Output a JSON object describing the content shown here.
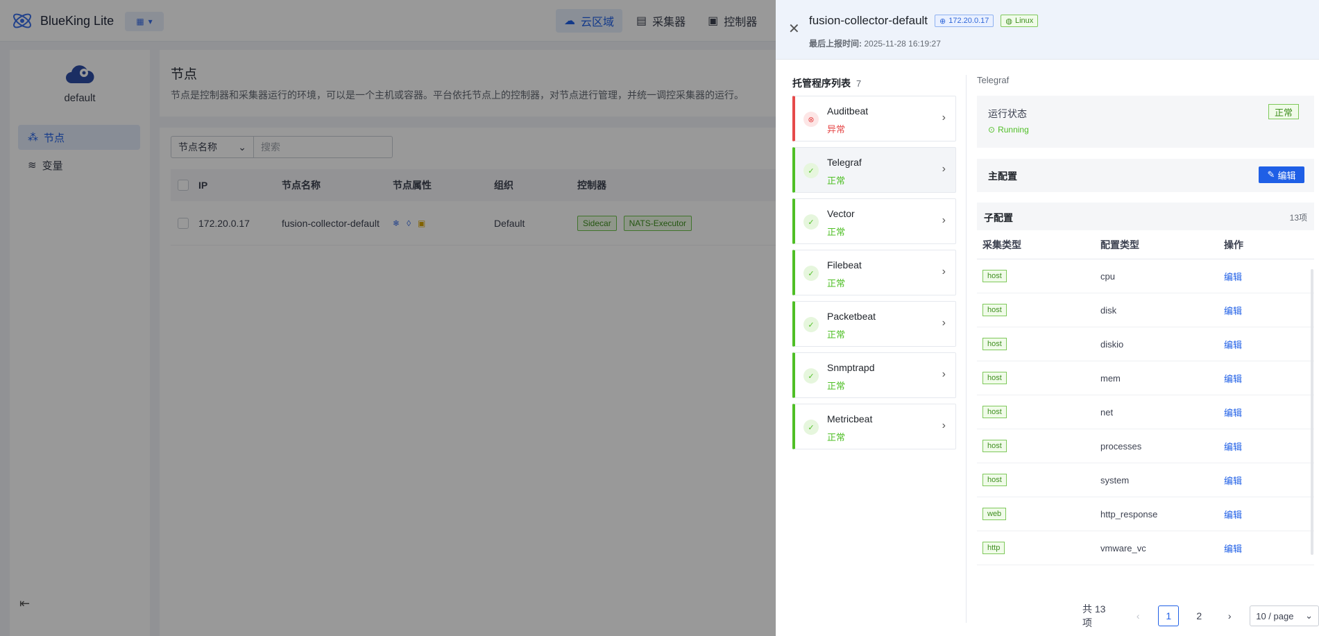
{
  "app": {
    "title": "BlueKing Lite"
  },
  "topnav": [
    {
      "label": "云区域",
      "icon": "cloud-icon",
      "active": true
    },
    {
      "label": "采集器",
      "icon": "collector-icon"
    },
    {
      "label": "控制器",
      "icon": "controller-icon"
    }
  ],
  "sidebar": {
    "cloud_name": "default",
    "items": [
      {
        "label": "节点",
        "active": true
      },
      {
        "label": "变量"
      }
    ]
  },
  "content": {
    "title": "节点",
    "description": "节点是控制器和采集器运行的环境，可以是一个主机或容器。平台依托节点上的控制器，对节点进行管理，并统一调控采集器的运行。",
    "filter": {
      "select": "节点名称",
      "placeholder": "搜索"
    },
    "table": {
      "headers": [
        "IP",
        "节点名称",
        "节点属性",
        "组织",
        "控制器"
      ],
      "rows": [
        {
          "ip": "172.20.0.17",
          "name": "fusion-collector-default",
          "org": "Default",
          "controllers": [
            "Sidecar",
            "NATS-Executor"
          ]
        }
      ]
    }
  },
  "drawer": {
    "name": "fusion-collector-default",
    "ip": "172.20.0.17",
    "os": "Linux",
    "last_report_label": "最后上报时间:",
    "last_report": "2025-11-28 16:19:27",
    "program_list_title": "托管程序列表",
    "program_count": "7",
    "programs": [
      {
        "name": "Auditbeat",
        "status": "异常",
        "state": "error"
      },
      {
        "name": "Telegraf",
        "status": "正常",
        "state": "ok"
      },
      {
        "name": "Vector",
        "status": "正常",
        "state": "ok"
      },
      {
        "name": "Filebeat",
        "status": "正常",
        "state": "ok"
      },
      {
        "name": "Packetbeat",
        "status": "正常",
        "state": "ok"
      },
      {
        "name": "Snmptrapd",
        "status": "正常",
        "state": "ok"
      },
      {
        "name": "Metricbeat",
        "status": "正常",
        "state": "ok"
      }
    ],
    "detail": {
      "title": "Telegraf",
      "run_status_label": "运行状态",
      "run_status_tag": "正常",
      "run_status_value": "Running",
      "main_config_label": "主配置",
      "edit_label": "编辑",
      "sub_config_label": "子配置",
      "sub_config_count": "13项",
      "headers": [
        "采集类型",
        "配置类型",
        "操作"
      ],
      "rows": [
        {
          "type": "host",
          "config": "cpu",
          "action": "编辑"
        },
        {
          "type": "host",
          "config": "disk",
          "action": "编辑"
        },
        {
          "type": "host",
          "config": "diskio",
          "action": "编辑"
        },
        {
          "type": "host",
          "config": "mem",
          "action": "编辑"
        },
        {
          "type": "host",
          "config": "net",
          "action": "编辑"
        },
        {
          "type": "host",
          "config": "processes",
          "action": "编辑"
        },
        {
          "type": "host",
          "config": "system",
          "action": "编辑"
        },
        {
          "type": "web",
          "config": "http_response",
          "action": "编辑"
        },
        {
          "type": "http",
          "config": "vmware_vc",
          "action": "编辑"
        }
      ]
    },
    "pagination": {
      "total": "共 13 项",
      "pages": [
        "1",
        "2"
      ],
      "page_size": "10 / page"
    }
  },
  "colors": {
    "primary": "#1f5fe6",
    "ok": "#4fbf26",
    "error": "#e64a4a"
  }
}
